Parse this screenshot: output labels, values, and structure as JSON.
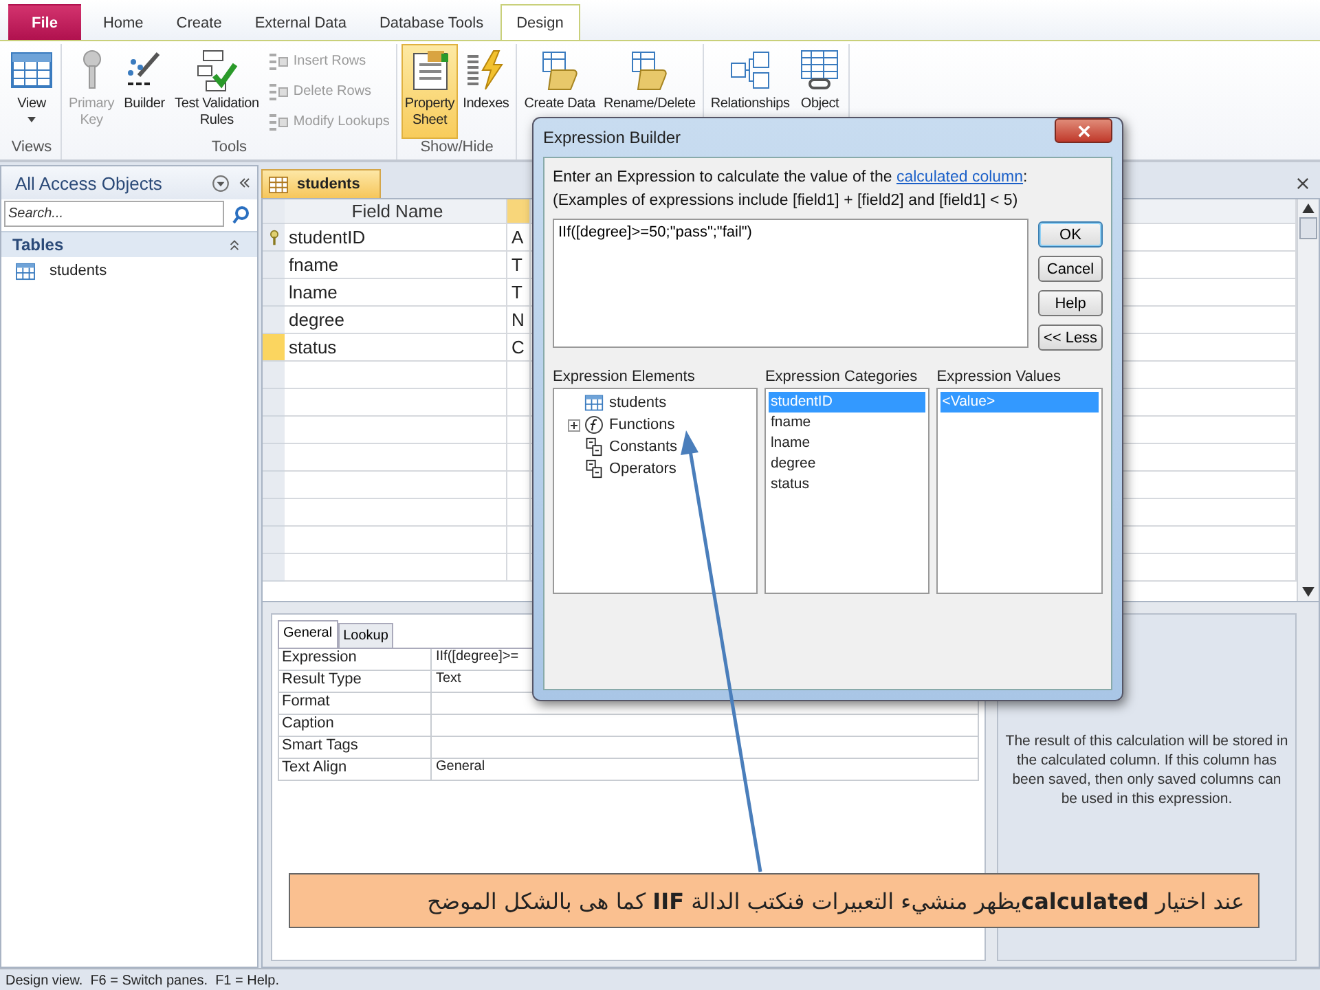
{
  "ribbon_tabs": [
    {
      "label": "File",
      "kind": "file",
      "selected": false
    },
    {
      "label": "Home",
      "kind": "tab",
      "selected": false
    },
    {
      "label": "Create",
      "kind": "tab",
      "selected": false
    },
    {
      "label": "External Data",
      "kind": "tab",
      "selected": false
    },
    {
      "label": "Database Tools",
      "kind": "tab",
      "selected": false
    },
    {
      "label": "Design",
      "kind": "tab",
      "selected": true
    }
  ],
  "ribbon_groups": [
    {
      "label": "Views",
      "buttons": [
        {
          "lines": [
            "View"
          ],
          "kind": "large",
          "dropdown": true,
          "disabled": false,
          "on": false
        }
      ]
    },
    {
      "label": "Tools",
      "buttons": [
        {
          "lines": [
            "Primary",
            "Key"
          ],
          "kind": "large",
          "disabled": true,
          "on": false
        },
        {
          "lines": [
            "Builder"
          ],
          "kind": "large",
          "disabled": false,
          "on": false
        },
        {
          "lines": [
            "Test Validation",
            "Rules"
          ],
          "kind": "large",
          "disabled": false,
          "on": false
        },
        {
          "lines": [
            "Insert Rows"
          ],
          "kind": "small",
          "disabled": true
        },
        {
          "lines": [
            "Delete Rows"
          ],
          "kind": "small",
          "disabled": true
        },
        {
          "lines": [
            "Modify Lookups"
          ],
          "kind": "small",
          "disabled": true
        }
      ]
    },
    {
      "label": "Show/Hide",
      "buttons": [
        {
          "lines": [
            "Property",
            "Sheet"
          ],
          "kind": "large",
          "disabled": false,
          "on": true
        },
        {
          "lines": [
            "Indexes"
          ],
          "kind": "large",
          "disabled": false,
          "on": false
        }
      ]
    },
    {
      "buttons": [
        {
          "lines": [
            "Create Data"
          ],
          "kind": "large",
          "disabled": false,
          "on": false
        },
        {
          "lines": [
            "Rename/Delete"
          ],
          "kind": "large",
          "disabled": false,
          "on": false
        }
      ]
    },
    {
      "buttons": [
        {
          "lines": [
            "Relationships"
          ],
          "kind": "large",
          "disabled": false,
          "on": false
        },
        {
          "lines": [
            "Object"
          ],
          "kind": "large",
          "disabled": false,
          "on": false
        }
      ]
    }
  ],
  "nav_pane": {
    "title": "All Access Objects",
    "search": {
      "placeholder": "Search..."
    },
    "sections": [
      {
        "title": "Tables",
        "expanded": true,
        "items": [
          {
            "label": "students"
          }
        ]
      }
    ]
  },
  "document": {
    "tab": "students",
    "grid": {
      "columns": [
        "Field Name"
      ],
      "rows": [
        {
          "name": "studentID",
          "data_type": "A",
          "primary_key": true,
          "selected": false
        },
        {
          "name": "fname",
          "data_type": "T",
          "primary_key": false,
          "selected": false
        },
        {
          "name": "lname",
          "data_type": "T",
          "primary_key": false,
          "selected": false
        },
        {
          "name": "degree",
          "data_type": "N",
          "primary_key": false,
          "selected": false
        },
        {
          "name": "status",
          "data_type": "C",
          "primary_key": false,
          "selected": true
        }
      ]
    },
    "properties": {
      "tabs": [
        {
          "label": "General",
          "selected": true
        },
        {
          "label": "Lookup",
          "selected": false
        }
      ],
      "rows": [
        {
          "name": "Expression",
          "value": "IIf([degree]>="
        },
        {
          "name": "Result Type",
          "value": "Text"
        },
        {
          "name": "Format"
        },
        {
          "name": "Caption"
        },
        {
          "name": "Smart Tags"
        },
        {
          "name": "Text Align",
          "value": "General"
        }
      ],
      "help": "The result of this calculation will be stored in the calculated column. If this column has been saved, then only saved columns can be used in this expression."
    }
  },
  "status_bar": {
    "text": "Design view.  F6 = Switch panes.  F1 = Help."
  },
  "dialog": {
    "title": "Expression Builder",
    "prompt": {
      "before": "Enter an Expression to calculate the value of the ",
      "link": "calculated column",
      "after": ":"
    },
    "examples": "(Examples of expressions include [field1] + [field2] and [field1] < 5)",
    "expression": "IIf([degree]>=50;\"pass\";\"fail\")",
    "buttons": [
      {
        "label": "OK",
        "default": true
      },
      {
        "label": "Cancel",
        "default": false
      },
      {
        "label": "Help",
        "default": false
      },
      {
        "label": "<< Less",
        "default": false
      }
    ],
    "elements": {
      "heading": "Expression Elements",
      "items": [
        {
          "label": "students",
          "kind": "table"
        },
        {
          "label": "Functions",
          "kind": "function",
          "expanded": false
        },
        {
          "label": "Constants",
          "kind": "group"
        },
        {
          "label": "Operators",
          "kind": "group"
        }
      ]
    },
    "categories": {
      "heading": "Expression Categories",
      "items": [
        {
          "label": "studentID",
          "selected": true
        },
        {
          "label": "fname",
          "selected": false
        },
        {
          "label": "lname",
          "selected": false
        },
        {
          "label": "degree",
          "selected": false
        },
        {
          "label": "status",
          "selected": false
        }
      ]
    },
    "values": {
      "heading": "Expression Values",
      "items": [
        {
          "label": "<Value>",
          "selected": true
        }
      ]
    }
  },
  "callout": {
    "text": "عند اختيار **calculated**يظهر منشيء التعبيرات فنكتب الدالة **IIF** كما هى بالشكل الموضح"
  }
}
